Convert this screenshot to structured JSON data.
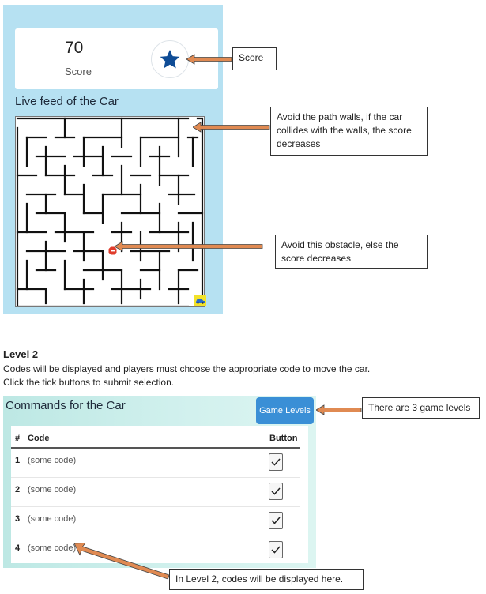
{
  "score": {
    "value": "70",
    "label": "Score"
  },
  "feed": {
    "title": "Live feed of the Car"
  },
  "callouts": {
    "score": "Score",
    "walls": "Avoid the path walls, if the car collides with the walls, the score decreases",
    "obstacle": "Avoid this obstacle, else the score decreases",
    "levels": "There are 3 game levels",
    "codes": "In Level 2, codes will be displayed here."
  },
  "level": {
    "heading": "Level 2",
    "line1": "Codes will be displayed and players must choose the appropriate code to move the car.",
    "line2": "Click the tick buttons to submit selection."
  },
  "commands": {
    "title": "Commands for the Car",
    "levels_button": "Game Levels",
    "columns": {
      "num": "#",
      "code": "Code",
      "button": "Button"
    },
    "rows": [
      {
        "num": "1",
        "code": "(some code)"
      },
      {
        "num": "2",
        "code": "(some code)"
      },
      {
        "num": "3",
        "code": "(some code)"
      },
      {
        "num": "4",
        "code": "(some code)"
      }
    ]
  },
  "icons": {
    "score": "star-icon",
    "obstacle": "stop-sign-icon",
    "car": "car-icon",
    "tick": "check-icon"
  },
  "colors": {
    "feed_panel": "#b6e1f2",
    "star": "#0f4c96",
    "levels_button": "#3a8fd6",
    "arrow": "#e08a52",
    "car_tile": "#f2e22a",
    "obstacle": "#e03c2c"
  }
}
